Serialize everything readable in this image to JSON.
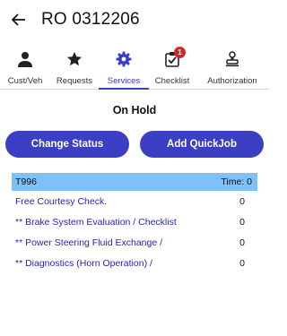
{
  "header": {
    "title": "RO 0312206",
    "back_icon": "arrow-left-icon"
  },
  "tabs": [
    {
      "label": "Cust/Veh",
      "icon": "person-icon",
      "active": false
    },
    {
      "label": "Requests",
      "icon": "star-icon",
      "active": false
    },
    {
      "label": "Services",
      "icon": "gear-icon",
      "active": true
    },
    {
      "label": "Checklist",
      "icon": "checklist-icon",
      "active": false,
      "badge": "1"
    },
    {
      "label": "Authorization",
      "icon": "stamp-icon",
      "active": false
    }
  ],
  "status": "On Hold",
  "buttons": {
    "change_status": "Change Status",
    "add_quickjob": "Add QuickJob"
  },
  "jobs": {
    "header_code": "T996",
    "header_time": "Time: 0",
    "rows": [
      {
        "name": "Free Courtesy Check.",
        "value": "0"
      },
      {
        "name": "** Brake System Evaluation / Checklist",
        "value": "0"
      },
      {
        "name": "** Power Steering Fluid Exchange /",
        "value": "0"
      },
      {
        "name": "** Diagnostics (Horn Operation) /",
        "value": "0"
      }
    ]
  },
  "colors": {
    "accent": "#3a3fc4",
    "badge": "#d0282a",
    "highlight_row": "#7ec0f7",
    "link": "#2327b8"
  }
}
